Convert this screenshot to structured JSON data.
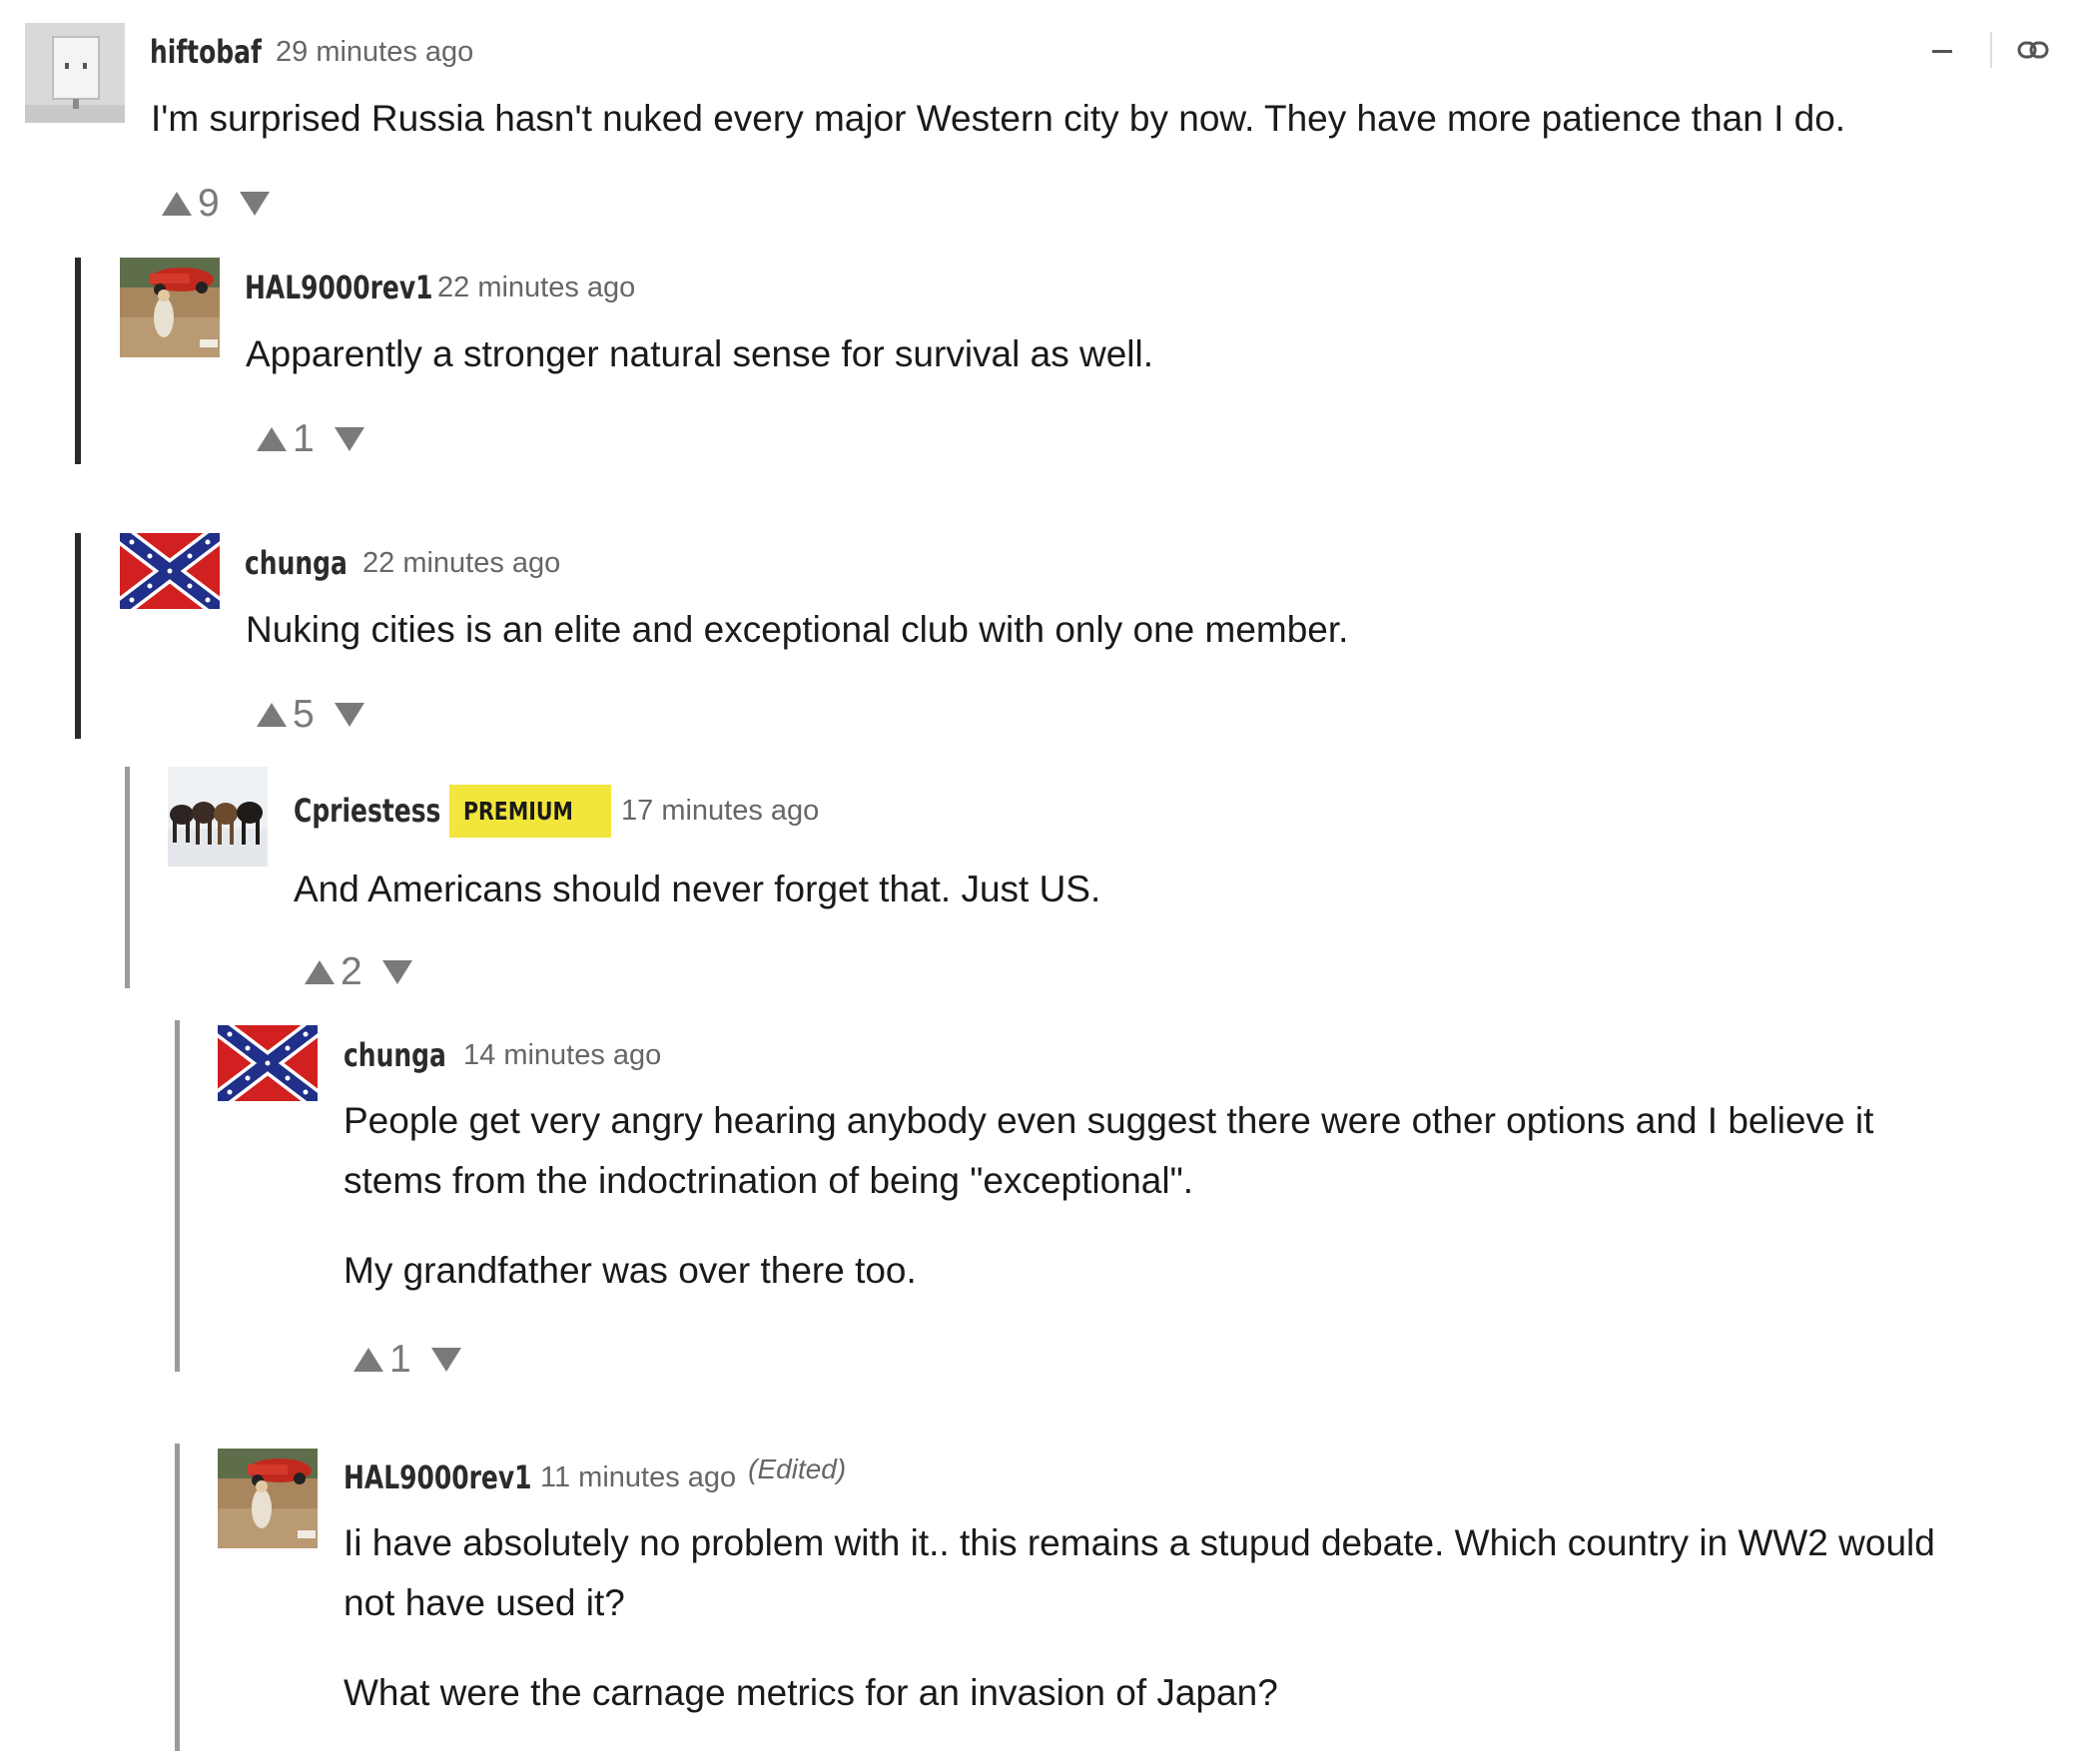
{
  "comments": [
    {
      "username": "hiftobaf",
      "time": "29 minutes ago",
      "text": [
        "I'm surprised Russia hasn't nuked every major Western city by now.  They have more patience than I do."
      ],
      "votes": "9",
      "avatar": "default-avatar"
    },
    {
      "username": "HAL9000rev1",
      "time": "22 minutes ago",
      "text": [
        "Apparently a stronger natural sense for survival as well."
      ],
      "votes": "1",
      "avatar": "photo-avatar"
    },
    {
      "username": "chunga",
      "time": "22 minutes ago",
      "text": [
        "Nuking cities is an elite and exceptional club with only one member."
      ],
      "votes": "5",
      "avatar": "flag-avatar"
    },
    {
      "username": "Cpriestess",
      "badge": "PREMIUM",
      "time": "17 minutes ago",
      "text": [
        "And Americans should never forget that.  Just US."
      ],
      "votes": "2",
      "avatar": "horses-avatar"
    },
    {
      "username": "chunga",
      "time": "14 minutes ago",
      "text": [
        "People get very angry hearing anybody even suggest there were other options and I believe it",
        "stems from the indoctrination of being \"exceptional\".",
        "My grandfather was over there too."
      ],
      "votes": "1",
      "avatar": "flag-avatar"
    },
    {
      "username": "HAL9000rev1",
      "time": "11 minutes ago",
      "edited": "(Edited)",
      "text": [
        "Ii have absolutely no problem with it.. this remains a stupud debate.  Which country in WW2 would",
        "not have used it?",
        "What were the carnage metrics for an invasion of Japan?"
      ],
      "avatar": "photo-avatar"
    }
  ],
  "controls": {
    "minimize_icon": "minus-icon",
    "link_icon": "link-icon"
  },
  "colors": {
    "premium_badge": "#f2e53b",
    "vote_arrow": "#7a7a7a",
    "thread_rail_dark": "#2a2a2a",
    "thread_rail_gray": "#9a9a9a"
  }
}
